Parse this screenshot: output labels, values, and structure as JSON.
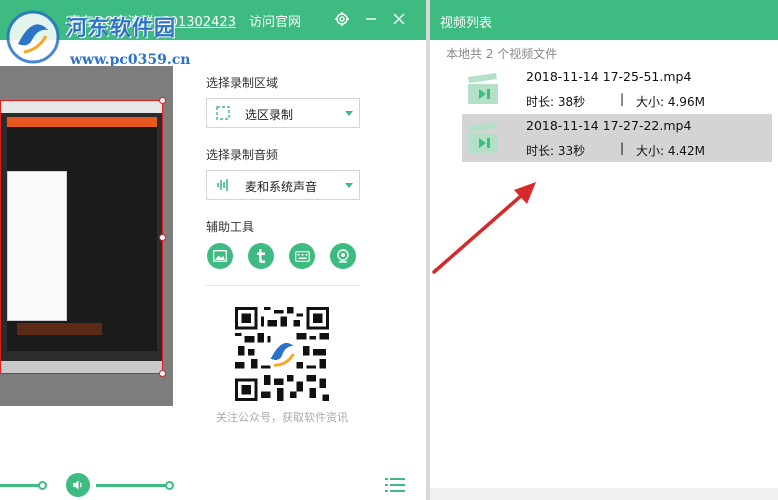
{
  "recorder": {
    "title": "嘉存QQ交流群",
    "qq_group": "601302423",
    "visit_label": "访问官网",
    "record_area_label": "选择录制区域",
    "record_area_value": "选区录制",
    "record_audio_label": "选择录制音频",
    "record_audio_value": "麦和系统声音",
    "tools_label": "辅助工具",
    "qr_caption": "关注公众号，获取软件资讯",
    "accent_color": "#3dbb80"
  },
  "watermark": {
    "title": "河东软件园",
    "url": "www.pc0359.cn"
  },
  "video_list": {
    "title": "视频列表",
    "local_count": "本地共 2 个视频文件",
    "separator": "|",
    "items": [
      {
        "name": "2018-11-14 17-25-51.mp4",
        "duration": "时长: 38秒",
        "size": "大小: 4.96M",
        "selected": false
      },
      {
        "name": "2018-11-14 17-27-22.mp4",
        "duration": "时长: 33秒",
        "size": "大小: 4.42M",
        "selected": true
      }
    ]
  },
  "icons": {
    "settings": "gear-icon",
    "minimize": "minimize-icon",
    "close": "close-icon",
    "area": "dashed-square-icon",
    "audio": "sound-wave-icon",
    "tools": [
      "image-icon",
      "text-t-icon",
      "keyboard-icon",
      "webcam-icon"
    ],
    "volume": "volume-icon",
    "list": "list-icon",
    "video": "clapperboard-icon"
  }
}
